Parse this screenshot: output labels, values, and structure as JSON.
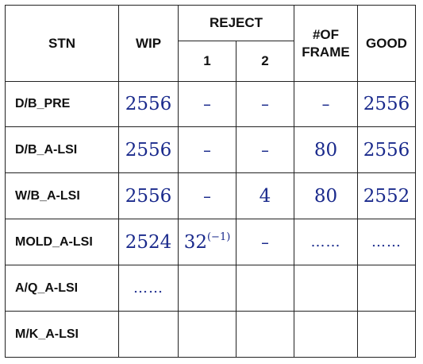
{
  "headers": {
    "stn": "STN",
    "wip": "WIP",
    "reject": "REJECT",
    "reject_1": "1",
    "reject_2": "2",
    "frame_line1": "#OF",
    "frame_line2": "FRAME",
    "good": "GOOD"
  },
  "rows": [
    {
      "stn": "D/B_PRE",
      "wip": "2556",
      "reject1": "–",
      "reject2": "–",
      "frame": "–",
      "good": "2556"
    },
    {
      "stn": "D/B_A-LSI",
      "wip": "2556",
      "reject1": "–",
      "reject2": "–",
      "frame": "80",
      "good": "2556"
    },
    {
      "stn": "W/B_A-LSI",
      "wip": "2556",
      "reject1": "–",
      "reject2": "4",
      "frame": "80",
      "good": "2552"
    },
    {
      "stn": "MOLD_A-LSI",
      "wip": "2524",
      "reject1": "32",
      "reject1_sup": "(−1)",
      "reject2": "–",
      "frame": "……",
      "good": "……"
    },
    {
      "stn": "A/Q_A-LSI",
      "wip": "……",
      "reject1": "",
      "reject2": "",
      "frame": "",
      "good": ""
    },
    {
      "stn": "M/K_A-LSI",
      "wip": "",
      "reject1": "",
      "reject2": "",
      "frame": "",
      "good": ""
    }
  ]
}
